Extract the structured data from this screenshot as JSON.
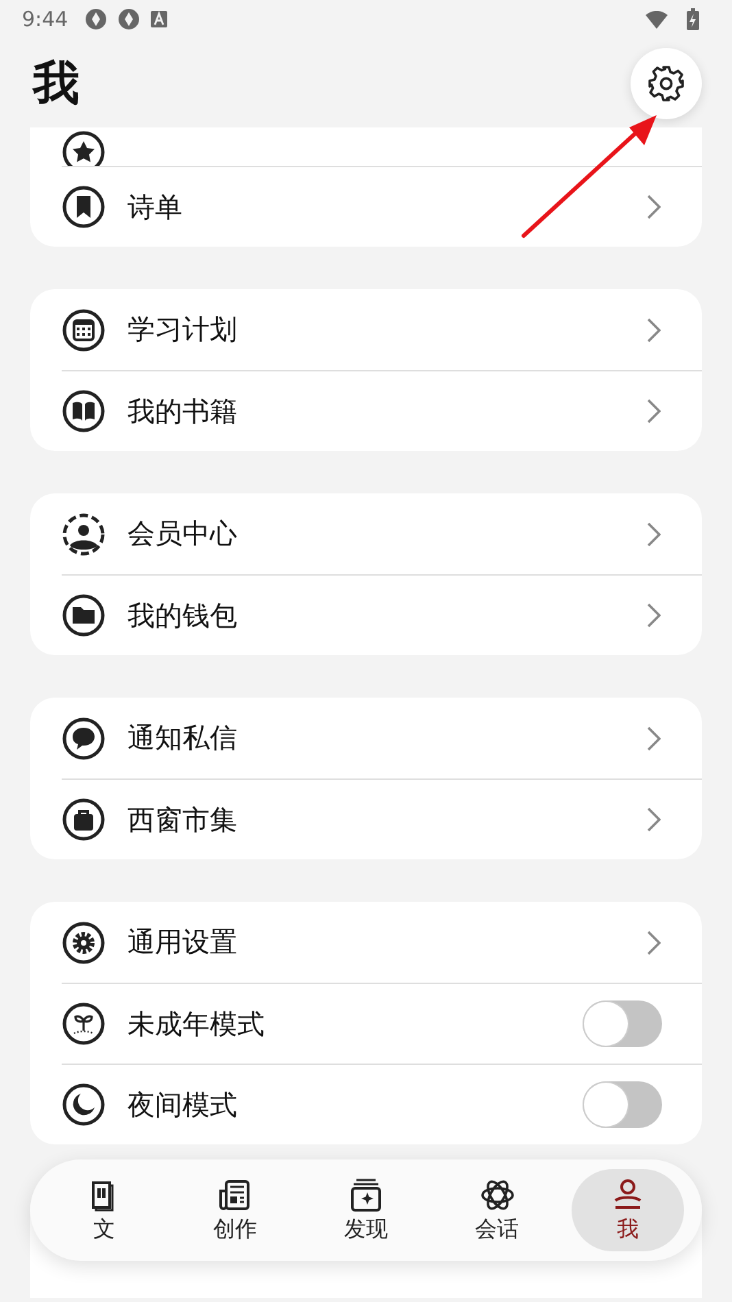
{
  "status_bar": {
    "time": "9:44"
  },
  "header": {
    "title": "我"
  },
  "groups": [
    {
      "items": [
        {
          "kind": "clipped"
        },
        {
          "kind": "link",
          "label": "诗单"
        }
      ]
    },
    {
      "items": [
        {
          "kind": "link",
          "label": "学习计划"
        },
        {
          "kind": "link",
          "label": "我的书籍"
        }
      ]
    },
    {
      "items": [
        {
          "kind": "link",
          "label": "会员中心"
        },
        {
          "kind": "link",
          "label": "我的钱包"
        }
      ]
    },
    {
      "items": [
        {
          "kind": "link",
          "label": "通知私信"
        },
        {
          "kind": "link",
          "label": "西窗市集"
        }
      ]
    },
    {
      "items": [
        {
          "kind": "link",
          "label": "通用设置"
        },
        {
          "kind": "toggle",
          "label": "未成年模式",
          "on": false
        },
        {
          "kind": "toggle",
          "label": "夜间模式",
          "on": false
        }
      ]
    }
  ],
  "nav": {
    "items": [
      {
        "label": "文",
        "selected": false
      },
      {
        "label": "创作",
        "selected": false
      },
      {
        "label": "发现",
        "selected": false
      },
      {
        "label": "会话",
        "selected": false
      },
      {
        "label": "我",
        "selected": true
      }
    ]
  }
}
